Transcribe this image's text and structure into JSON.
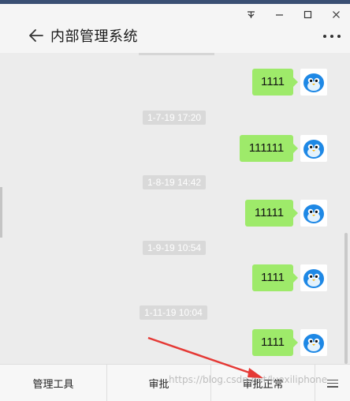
{
  "window": {
    "title": "内部管理系统",
    "controls": {
      "pin": "pin-icon",
      "minimize": "minimize-icon",
      "maximize": "maximize-icon",
      "close": "close-icon"
    }
  },
  "messages": [
    {
      "type": "message",
      "text": "1111"
    },
    {
      "type": "timestamp",
      "text": "1-7-19 17:20"
    },
    {
      "type": "message",
      "text": "111111"
    },
    {
      "type": "timestamp",
      "text": "1-8-19 14:42"
    },
    {
      "type": "message",
      "text": "11111"
    },
    {
      "type": "timestamp",
      "text": "1-9-19 10:54"
    },
    {
      "type": "message",
      "text": "1111"
    },
    {
      "type": "timestamp",
      "text": "1-11-19 10:04"
    },
    {
      "type": "message",
      "text": "1111"
    }
  ],
  "bottom_tabs": [
    "管理工具",
    "审批",
    "审批正常"
  ],
  "watermark": "https://blog.csdn.net/luexiliphone",
  "colors": {
    "bubble": "#9eea6a",
    "arrow": "#e53935",
    "avatar": "#1e88e5"
  }
}
